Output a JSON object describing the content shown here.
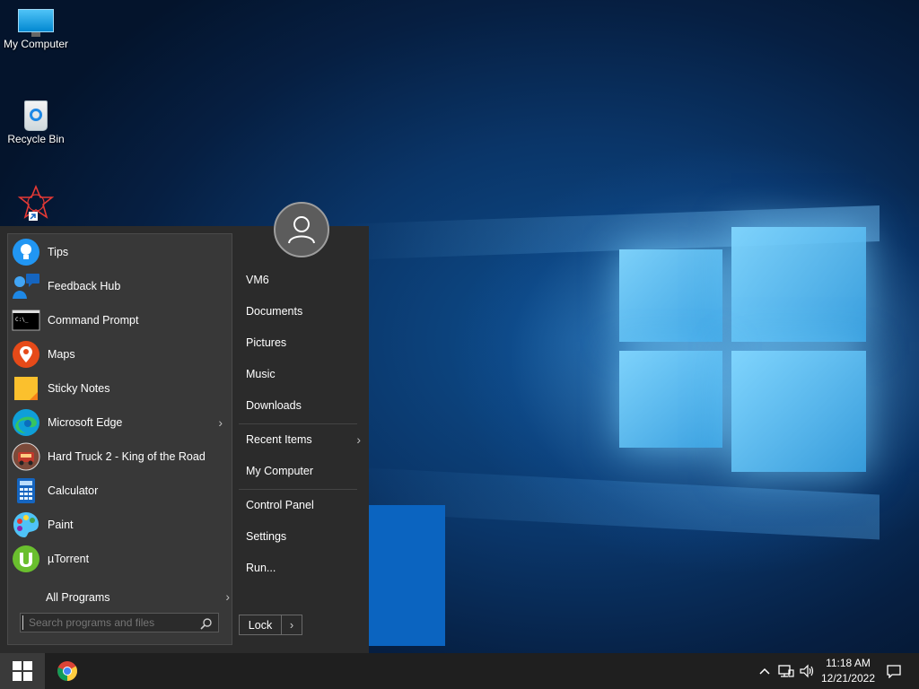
{
  "desktop": {
    "icons": [
      {
        "label": "My Computer",
        "icon": "monitor-icon"
      },
      {
        "label": "Recycle Bin",
        "icon": "recycle-bin-icon"
      },
      {
        "label": "",
        "icon": "program-shortcut-icon"
      }
    ]
  },
  "start_menu": {
    "programs": [
      {
        "label": "Tips",
        "icon": "lightbulb-icon",
        "color": "#2196f3"
      },
      {
        "label": "Feedback Hub",
        "icon": "feedback-hub-icon",
        "color": "#1e88e5"
      },
      {
        "label": "Command Prompt",
        "icon": "command-prompt-icon",
        "color": "#000000"
      },
      {
        "label": "Maps",
        "icon": "map-pin-icon",
        "color": "#e64a19"
      },
      {
        "label": "Sticky Notes",
        "icon": "sticky-notes-icon",
        "color": "#fbc02d"
      },
      {
        "label": "Microsoft Edge",
        "icon": "edge-icon",
        "color": "#0f9fd8",
        "has_submenu": true
      },
      {
        "label": "Hard Truck 2 - King of the Road",
        "icon": "truck-game-icon",
        "color": "#c0392b"
      },
      {
        "label": "Calculator",
        "icon": "calculator-icon",
        "color": "#1565c0"
      },
      {
        "label": "Paint",
        "icon": "paint-palette-icon",
        "color": "#4fc3f7"
      },
      {
        "label": "µTorrent",
        "icon": "utorrent-icon",
        "color": "#6abf2e"
      }
    ],
    "all_programs_label": "All Programs",
    "search": {
      "placeholder": "Search programs and files"
    },
    "right_items": [
      {
        "label": "VM6"
      },
      {
        "label": "Documents"
      },
      {
        "label": "Pictures"
      },
      {
        "label": "Music"
      },
      {
        "label": "Downloads"
      },
      {
        "label": "Recent Items",
        "has_submenu": true
      },
      {
        "label": "My Computer"
      },
      {
        "label": "Control Panel"
      },
      {
        "label": "Settings"
      },
      {
        "label": "Run..."
      }
    ],
    "lock_label": "Lock",
    "user_icon": "user-avatar-icon"
  },
  "taskbar": {
    "start_icon": "windows-logo-icon",
    "pinned": [
      {
        "name": "Google Chrome",
        "icon": "chrome-icon"
      }
    ],
    "tray": {
      "time": "11:18 AM",
      "date": "12/21/2022",
      "icons": [
        "chevron-up-icon",
        "network-icon",
        "volume-icon",
        "notification-icon"
      ]
    }
  },
  "colors": {
    "menu_bg": "#2b2b2b",
    "menu_panel_bg": "#383838",
    "taskbar_bg": "#1f1f1f",
    "accent_blue": "#0b64c0"
  }
}
